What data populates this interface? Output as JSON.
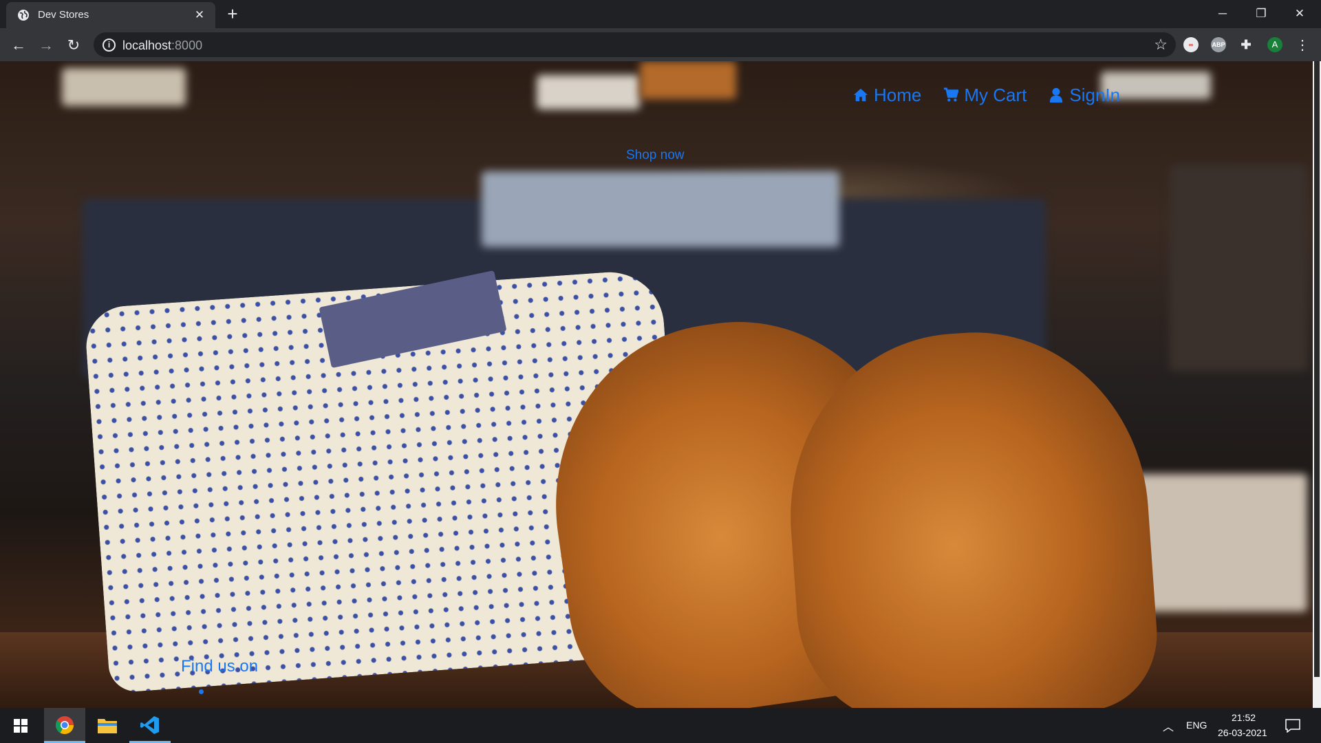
{
  "browser": {
    "tab_title": "Dev Stores",
    "url_host": "localhost",
    "url_port": ":8000",
    "profile_initial": "A",
    "extensions": [
      "glasses-extension-icon",
      "adblock-extension-icon",
      "puzzle-extensions-icon"
    ],
    "adblock_label": "ABP"
  },
  "site": {
    "nav": [
      {
        "label": "Home",
        "icon": "home-icon"
      },
      {
        "label": "My Cart",
        "icon": "cart-icon"
      },
      {
        "label": "SignIn",
        "icon": "user-icon"
      }
    ],
    "shop_now": "Shop now",
    "find_us": "Find us on"
  },
  "taskbar": {
    "language": "ENG",
    "time": "21:52",
    "date": "26-03-2021"
  },
  "colors": {
    "link": "#1877f2",
    "chrome_dark": "#202124",
    "chrome_toolbar": "#35363a"
  }
}
